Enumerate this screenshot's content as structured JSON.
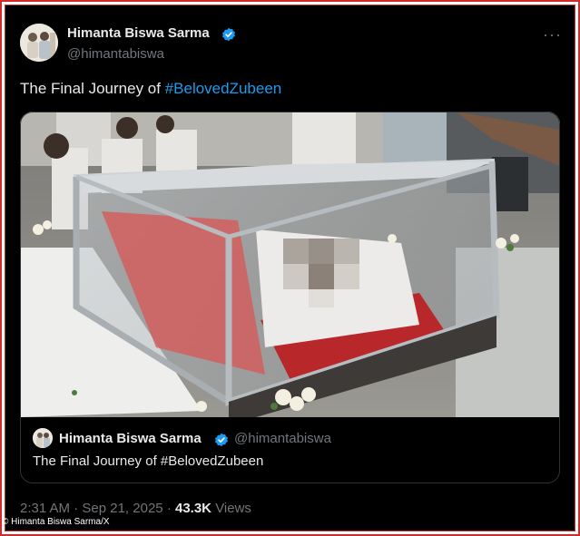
{
  "author": {
    "name": "Himanta Biswa Sarma",
    "handle": "@himantabiswa",
    "verified_color": "#1d9bf0"
  },
  "post": {
    "text_prefix": "The Final Journey of ",
    "hashtag": "#BelovedZubeen",
    "media_icon": "photo-image"
  },
  "quoted_post": {
    "name": "Himanta Biswa Sarma",
    "handle": "@himantabiswa",
    "text": "The Final Journey of #BelovedZubeen"
  },
  "footer": {
    "time": "2:31 AM",
    "separator": "·",
    "date": "Sep 21, 2025",
    "views_count": "43.3K",
    "views_label": "Views"
  },
  "credit": "© Himanta Biswa Sarma/X",
  "more_icon": "more-horizontal-icon"
}
